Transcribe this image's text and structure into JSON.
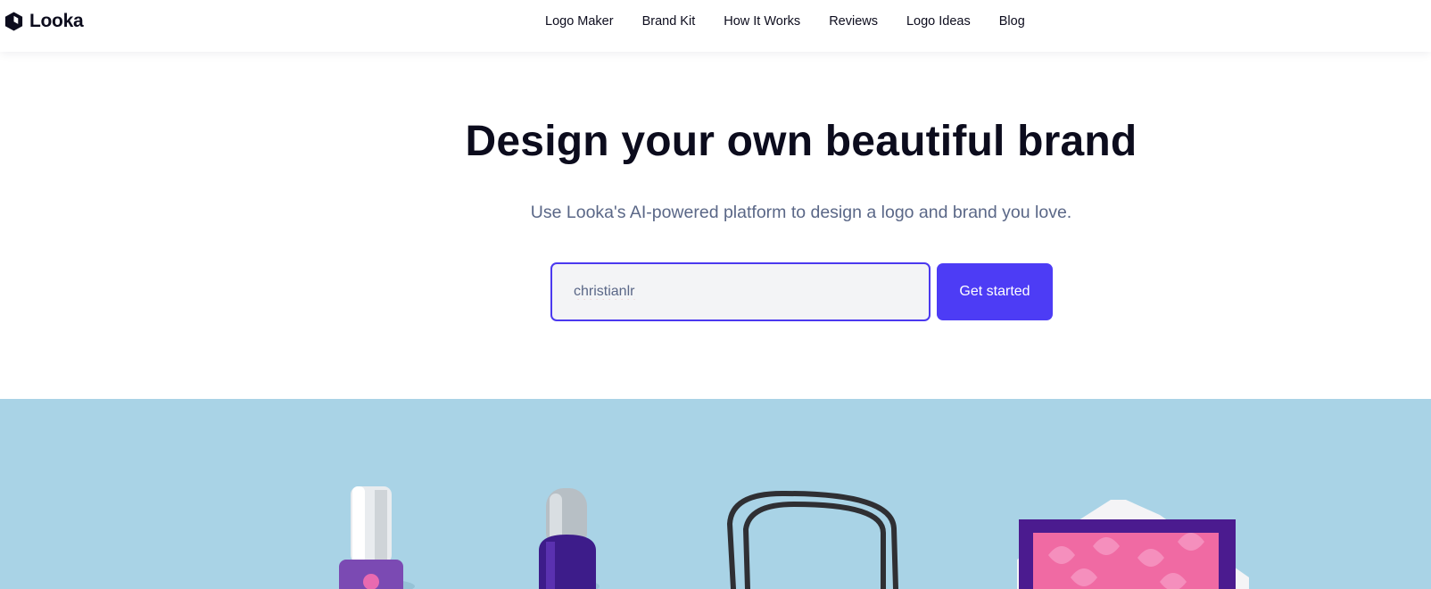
{
  "header": {
    "brand_name": "Looka",
    "logo_icon": "looka-hexagon-logo-icon",
    "nav": [
      {
        "label": "Logo Maker"
      },
      {
        "label": "Brand Kit"
      },
      {
        "label": "How It Works"
      },
      {
        "label": "Reviews"
      },
      {
        "label": "Logo Ideas"
      },
      {
        "label": "Blog"
      }
    ]
  },
  "hero": {
    "title": "Design your own beautiful brand",
    "subtitle": "Use Looka's AI-powered platform to design a logo and brand you love.",
    "input_value": "christianlr",
    "cta_label": "Get started"
  },
  "colors": {
    "accent": "#4d3cf5",
    "banner_bg": "#a9d3e6",
    "subtitle_text": "#5a6787"
  }
}
